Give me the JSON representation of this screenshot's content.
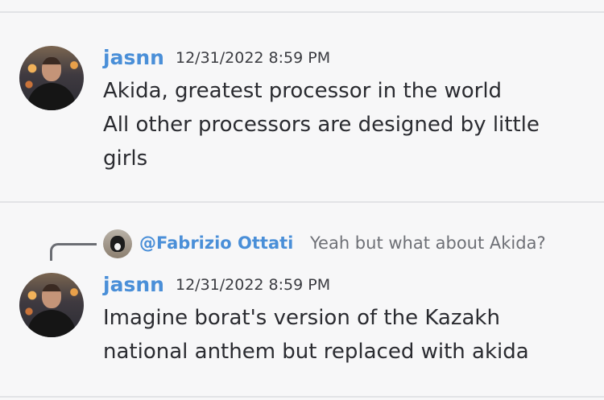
{
  "messages": [
    {
      "author": "jasnn",
      "timestamp": "12/31/2022 8:59 PM",
      "lines": [
        "Akida, greatest processor in the world",
        "All other processors are designed by little",
        "girls"
      ]
    },
    {
      "reply": {
        "mention": "@Fabrizio Ottati",
        "preview": "Yeah but what about Akida?"
      },
      "author": "jasnn",
      "timestamp": "12/31/2022 8:59 PM",
      "lines": [
        "Imagine borat's version of the Kazakh",
        "national anthem but replaced with akida"
      ]
    }
  ],
  "colors": {
    "background": "#f7f7f8",
    "author": "#4a8fd8",
    "text": "#2a2b30",
    "muted": "#6e7076",
    "divider": "#e2e3e6"
  },
  "icons": {
    "reply_connector": "reply-connector-icon"
  }
}
